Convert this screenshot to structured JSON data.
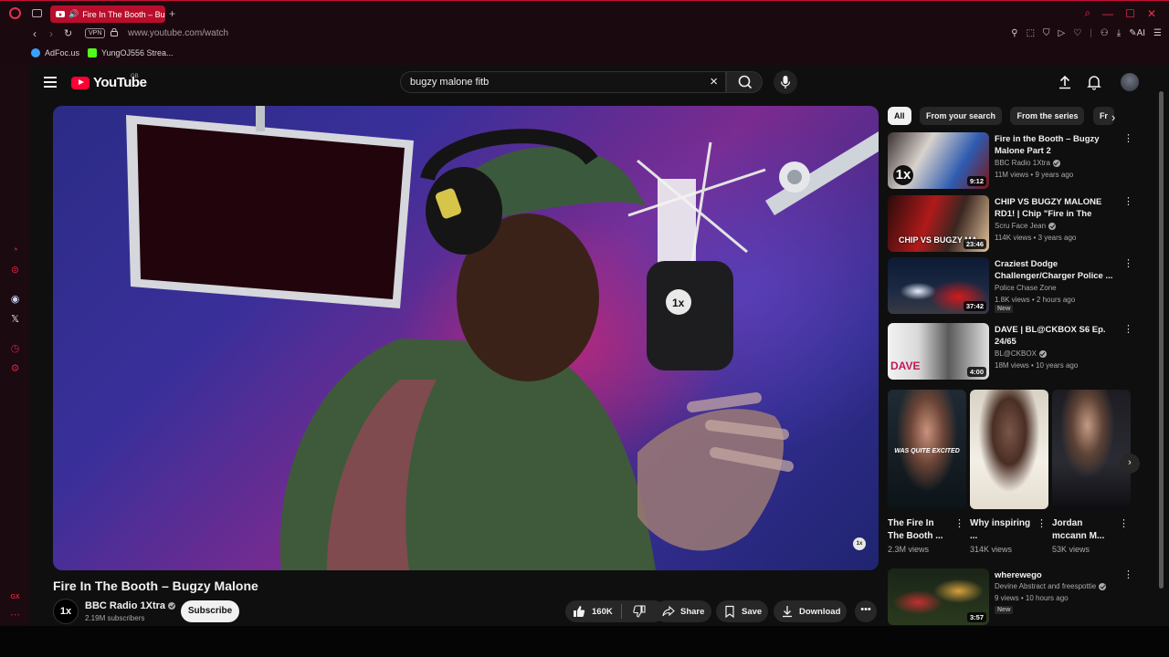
{
  "browser": {
    "tab_title": "Fire In The Booth – Bugzy Malone",
    "new_tab": "+",
    "url": "www.youtube.com/watch",
    "vpn": "VPN",
    "ai_label": "AI",
    "bookmarks": [
      {
        "label": "AdFoc.us",
        "color": "#3aa0ff"
      },
      {
        "label": "YungOJ556 Strea...",
        "color": "#53fc18"
      }
    ],
    "accent": "#c8123a"
  },
  "header": {
    "logo": "YouTube",
    "country": "GB",
    "search_query": "bugzy malone fitb"
  },
  "video": {
    "title": "Fire In The Booth – Bugzy Malone",
    "channel_avatar": "1x",
    "watermark": "1x",
    "channel": "BBC Radio 1Xtra",
    "subscribers": "2.19M subscribers",
    "subscribe_label": "Subscribe",
    "likes": "160K",
    "share_label": "Share",
    "save_label": "Save",
    "download_label": "Download"
  },
  "chips": [
    "All",
    "From your search",
    "From the series",
    "Fr"
  ],
  "recommendations": [
    {
      "title": "Fire in the Booth – Bugzy Malone Part 2",
      "channel": "BBC Radio 1Xtra",
      "verified": true,
      "meta": "11M views • 9 years ago",
      "duration": "9:12",
      "badge": ""
    },
    {
      "title": "CHIP VS BUGZY MALONE RD1! | Chip \"Fire in The Booth 2\" & ...",
      "channel": "Scru Face Jean",
      "verified": true,
      "meta": "114K views • 3 years ago",
      "duration": "23:46",
      "badge": ""
    },
    {
      "title": "Craziest Dodge Challenger/Charger Police ...",
      "channel": "Police Chase Zone",
      "verified": false,
      "meta": "1.8K views • 2 hours ago",
      "duration": "37:42",
      "badge": "New"
    },
    {
      "title": "DAVE | BL@CKBOX S6 Ep. 24/65",
      "channel": "BL@CKBOX",
      "verified": true,
      "meta": "18M views • 10 years ago",
      "duration": "4:00",
      "badge": ""
    }
  ],
  "shorts": [
    {
      "title": "The Fire In The Booth ...",
      "views": "2.3M views",
      "caption": "WAS QUITE EXCITED"
    },
    {
      "title": "Why inspiring ...",
      "views": "314K views",
      "caption": ""
    },
    {
      "title": "Jordan mccann M...",
      "views": "53K views",
      "caption": ""
    }
  ],
  "last_rec": {
    "title": "wherewego",
    "channel": "Devine Abstract and freespottie",
    "verified": true,
    "meta": "9 views • 10 hours ago",
    "duration": "3:57",
    "badge": "New"
  }
}
